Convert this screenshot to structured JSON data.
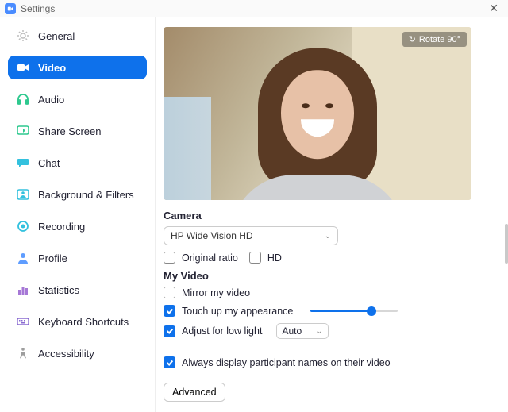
{
  "titlebar": {
    "title": "Settings"
  },
  "sidebar": {
    "items": [
      {
        "id": "general",
        "label": "General",
        "icon": "gear-icon",
        "iconColor": "#bdbdbd",
        "active": false
      },
      {
        "id": "video",
        "label": "Video",
        "icon": "video-icon",
        "iconColor": "#ffffff",
        "active": true
      },
      {
        "id": "audio",
        "label": "Audio",
        "icon": "headphone-icon",
        "iconColor": "#2fc98f",
        "active": false
      },
      {
        "id": "share-screen",
        "label": "Share Screen",
        "icon": "share-screen-icon",
        "iconColor": "#2fc98f",
        "active": false
      },
      {
        "id": "chat",
        "label": "Chat",
        "icon": "chat-icon",
        "iconColor": "#33c1de",
        "active": false
      },
      {
        "id": "background-filters",
        "label": "Background & Filters",
        "icon": "background-icon",
        "iconColor": "#33c1de",
        "active": false
      },
      {
        "id": "recording",
        "label": "Recording",
        "icon": "recording-icon",
        "iconColor": "#33c1de",
        "active": false
      },
      {
        "id": "profile",
        "label": "Profile",
        "icon": "profile-icon",
        "iconColor": "#5f9dff",
        "active": false
      },
      {
        "id": "statistics",
        "label": "Statistics",
        "icon": "statistics-icon",
        "iconColor": "#a678d6",
        "active": false
      },
      {
        "id": "keyboard-shortcuts",
        "label": "Keyboard Shortcuts",
        "icon": "keyboard-icon",
        "iconColor": "#8a6bd1",
        "active": false
      },
      {
        "id": "accessibility",
        "label": "Accessibility",
        "icon": "accessibility-icon",
        "iconColor": "#9e9e9e",
        "active": false
      }
    ]
  },
  "preview": {
    "rotate_label": "Rotate 90°"
  },
  "camera": {
    "section_title": "Camera",
    "selected": "HP Wide Vision HD",
    "original_ratio_label": "Original ratio",
    "original_ratio_checked": false,
    "hd_label": "HD",
    "hd_checked": false
  },
  "my_video": {
    "section_title": "My Video",
    "mirror_label": "Mirror my video",
    "mirror_checked": false,
    "touchup_label": "Touch up my appearance",
    "touchup_checked": true,
    "touchup_slider_pct": 70,
    "lowlight_label": "Adjust for low light",
    "lowlight_checked": true,
    "lowlight_mode": "Auto"
  },
  "participants": {
    "always_names_label": "Always display participant names on their video",
    "always_names_checked": true
  },
  "advanced_label": "Advanced"
}
